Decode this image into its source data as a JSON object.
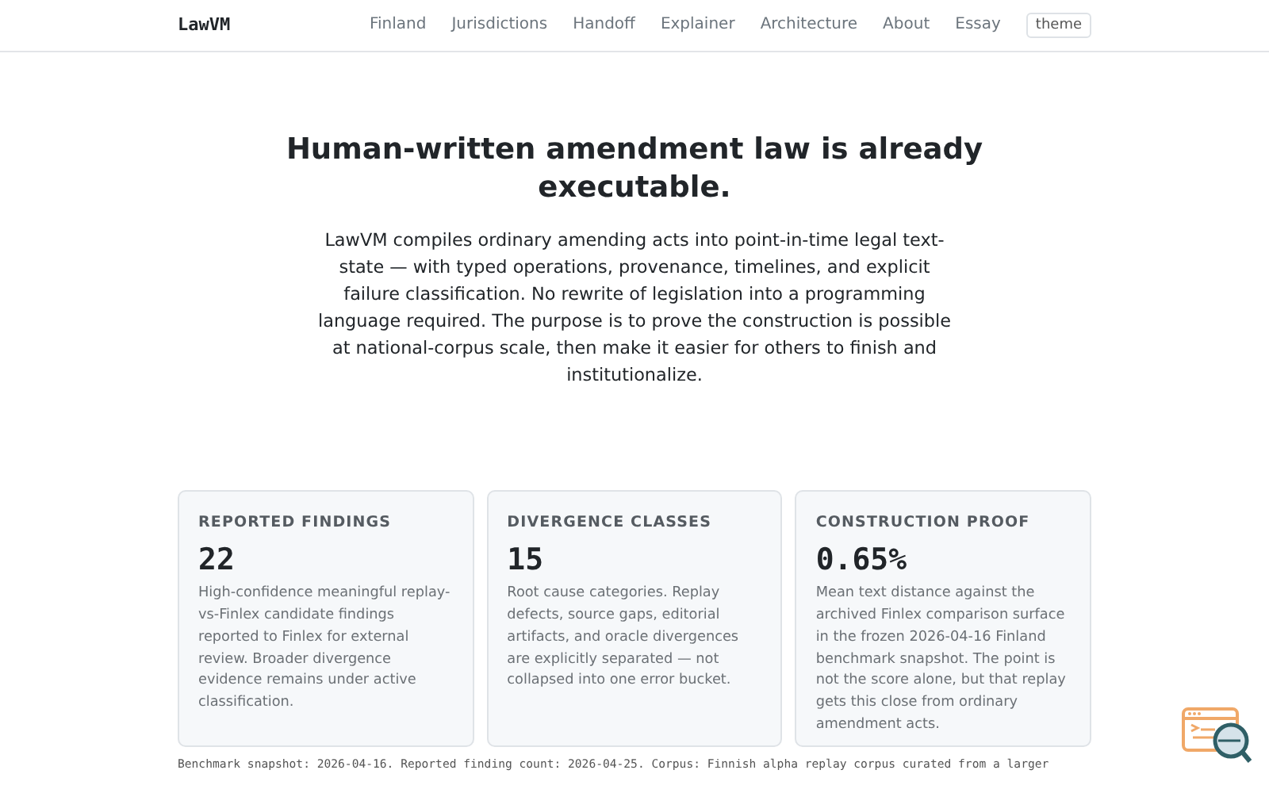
{
  "navbar": {
    "brand": "LawVM",
    "links": [
      "Finland",
      "Jurisdictions",
      "Handoff",
      "Explainer",
      "Architecture",
      "About",
      "Essay"
    ],
    "theme_button": "theme"
  },
  "hero": {
    "title": "Human-written amendment law is already executable.",
    "lead": "LawVM compiles ordinary amending acts into point-in-time legal text-state — with typed operations, provenance, timelines, and explicit failure classification. No rewrite of legislation into a programming language required. The purpose is to prove the construction is possible at national-corpus scale, then make it easier for others to finish and institutionalize."
  },
  "stats": [
    {
      "label": "REPORTED FINDINGS",
      "value": "22",
      "text": "High-confidence meaningful replay-vs-Finlex candidate findings reported to Finlex for external review. Broader divergence evidence remains under active classification."
    },
    {
      "label": "DIVERGENCE CLASSES",
      "value": "15",
      "text": "Root cause categories. Replay defects, source gaps, editorial artifacts, and oracle divergences are explicitly separated — not collapsed into one error bucket."
    },
    {
      "label": "CONSTRUCTION PROOF",
      "value": "0.65%",
      "text": "Mean text distance against the archived Finlex comparison surface in the frozen 2026-04-16 Finland benchmark snapshot. The point is not the score alone, but that replay gets this close from ordinary amendment acts."
    }
  ],
  "footnote": "Benchmark snapshot: 2026-04-16. Reported finding count: 2026-04-25. Corpus: Finnish alpha replay corpus curated from a larger"
}
